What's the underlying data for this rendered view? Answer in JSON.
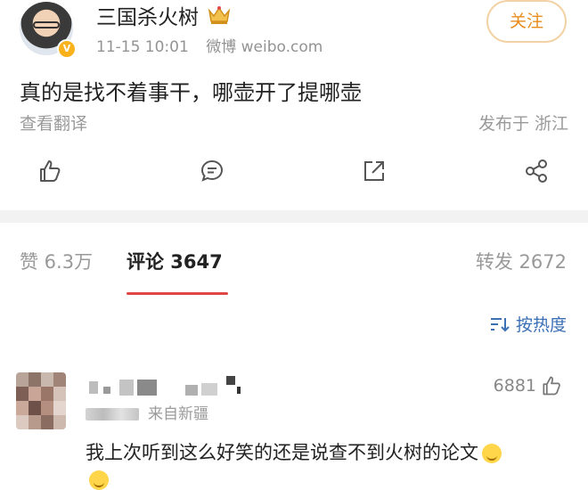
{
  "post": {
    "username": "三国杀火树",
    "time": "11-15 10:01",
    "source": "微博 weibo.com",
    "follow_label": "关注",
    "text": "真的是找不着事干，哪壶开了提哪壶",
    "translate_label": "查看翻译",
    "location": "发布于 浙江"
  },
  "actions": [
    "thumbs-up-icon",
    "comment-icon",
    "share-icon",
    "more-share-icon"
  ],
  "tabs": {
    "likes": "赞 6.3万",
    "comments": "评论 3647",
    "reposts": "转发 2672"
  },
  "sort_label": "按热度",
  "comment": {
    "location": "来自新疆",
    "like_count": "6881",
    "text": "我上次听到这么好笑的还是说查不到火树的论文"
  },
  "colors": {
    "accent": "#e88d1b",
    "link": "#3b6fb6",
    "underline": "#e04646"
  }
}
